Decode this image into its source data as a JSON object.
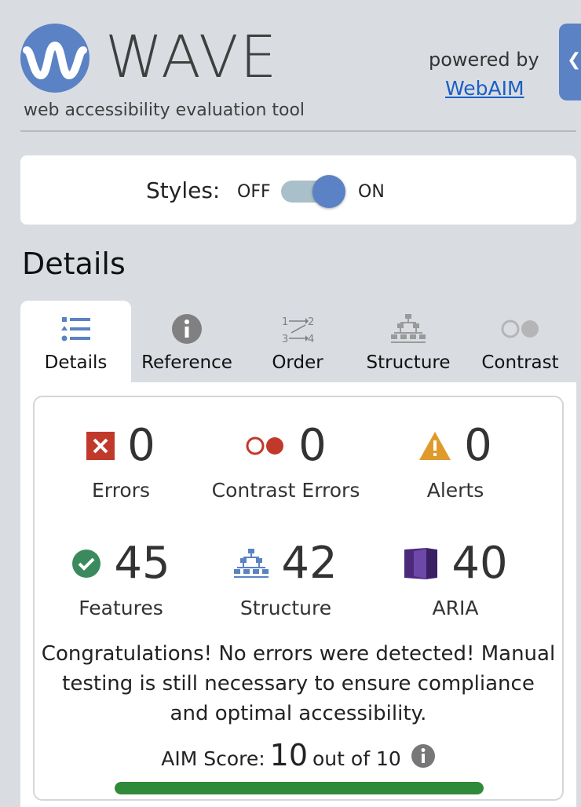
{
  "header": {
    "title": "WAVE",
    "subtitle": "web accessibility evaluation tool",
    "powered_by": "powered by",
    "powered_link": "WebAIM"
  },
  "styles": {
    "label": "Styles:",
    "off": "OFF",
    "on": "ON",
    "enabled": true
  },
  "section_title": "Details",
  "tabs": [
    {
      "label": "Details",
      "icon": "details-list-icon",
      "active": true
    },
    {
      "label": "Reference",
      "icon": "info-icon",
      "active": false
    },
    {
      "label": "Order",
      "icon": "order-icon",
      "active": false
    },
    {
      "label": "Structure",
      "icon": "structure-icon",
      "active": false
    },
    {
      "label": "Contrast",
      "icon": "contrast-icon",
      "active": false
    }
  ],
  "stats": [
    {
      "label": "Errors",
      "value": "0",
      "icon": "error-icon"
    },
    {
      "label": "Contrast Errors",
      "value": "0",
      "icon": "contrast-error-icon"
    },
    {
      "label": "Alerts",
      "value": "0",
      "icon": "alert-icon"
    },
    {
      "label": "Features",
      "value": "45",
      "icon": "feature-check-icon"
    },
    {
      "label": "Structure",
      "value": "42",
      "icon": "structure-icon"
    },
    {
      "label": "ARIA",
      "value": "40",
      "icon": "aria-icon"
    }
  ],
  "message": "Congratulations! No errors were detected! Manual testing is still necessary to ensure compliance and optimal accessibility.",
  "aim": {
    "label": "AIM Score:",
    "value": "10",
    "out_of": "out of 10",
    "fraction": 1.0
  },
  "colors": {
    "brand_blue": "#5a82c4",
    "error_red": "#c0392b",
    "alert_orange": "#e09a2c",
    "feature_green": "#2f8a3a",
    "aria_purple": "#4b2a7c",
    "link_blue": "#1a5fc4"
  }
}
